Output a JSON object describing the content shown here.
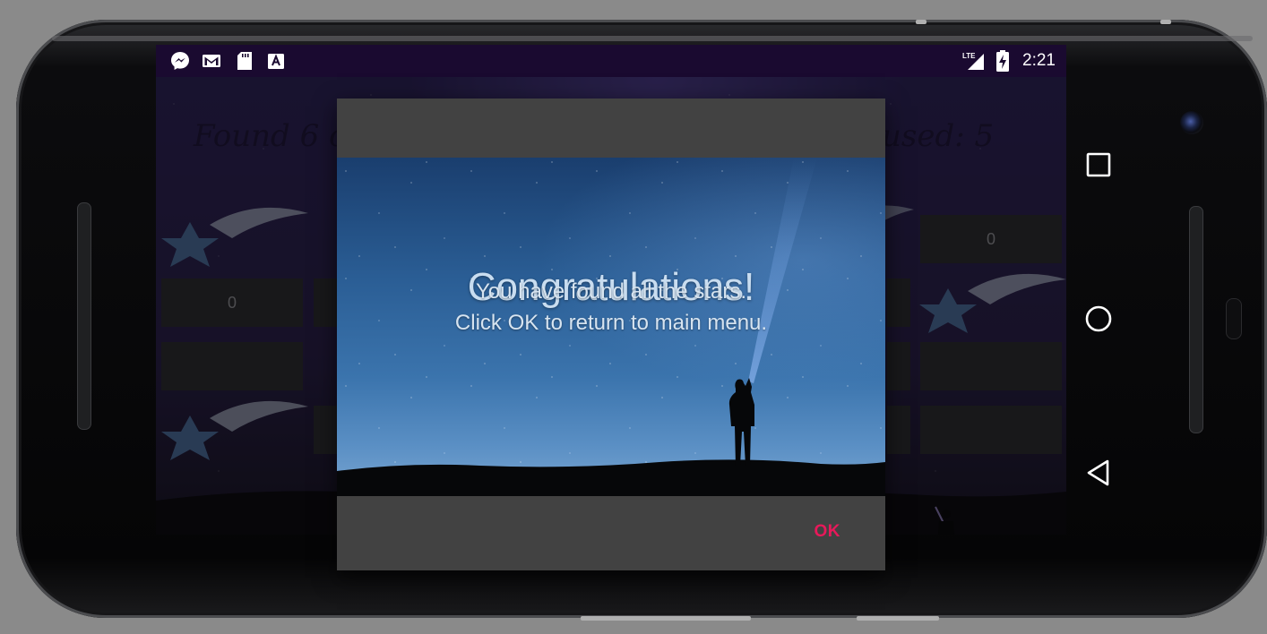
{
  "status_bar": {
    "time": "2:21",
    "left_icons": [
      "messenger-icon",
      "gmail-icon",
      "sd-card-icon",
      "keyboard-a-icon"
    ],
    "network_label": "LTE"
  },
  "game": {
    "header_left": "Found 6 of",
    "header_right": "used: 5",
    "tile_values": [
      "0",
      "0"
    ]
  },
  "dialog": {
    "title": "Congratulations!",
    "message_line1": "You have found all the stars.",
    "message_line2": "Click OK to return to main menu.",
    "ok_label": "OK"
  },
  "nav_bar": {
    "buttons": [
      "recents-square-icon",
      "home-circle-icon",
      "back-triangle-icon"
    ]
  },
  "colors": {
    "accent": "#e8195a",
    "dialog_bg": "#424242",
    "statusbar_bg": "#1a0a30"
  }
}
